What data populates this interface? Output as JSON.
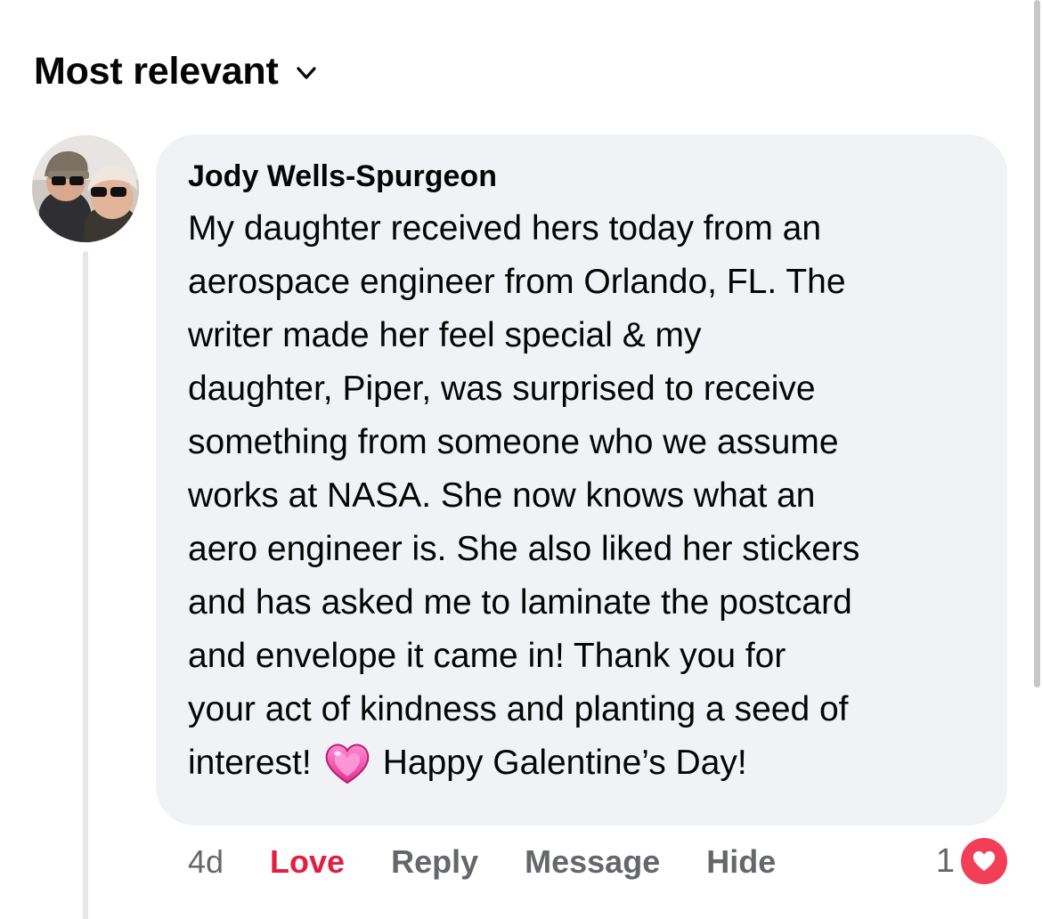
{
  "sort": {
    "label": "Most relevant",
    "chevron_icon": "chevron-down-icon"
  },
  "comment": {
    "author": "Jody Wells-Spurgeon",
    "text_main": "My daughter received hers today from an\naerospace engineer from Orlando, FL. The\nwriter made her feel special & my\ndaughter, Piper, was surprised to receive\nsomething from someone who we assume\nworks at NASA. She now knows what an\naero engineer is. She also liked her stickers\nand has asked me to laminate the postcard\nand envelope it came in! Thank you for\nyour act of kindness and planting a seed of",
    "text_before_emoji": "interest!",
    "emoji": "sparkling-heart-emoji",
    "text_after_emoji": "Happy Galentine’s Day!"
  },
  "actions": {
    "time": "4d",
    "love_label": "Love",
    "reply_label": "Reply",
    "message_label": "Message",
    "hide_label": "Hide"
  },
  "reactions": {
    "count": "1",
    "icon": "love-reaction-icon",
    "color": "#f33e58"
  },
  "colors": {
    "bubble_bg": "#f0f2f5",
    "love_active": "#e41e3f",
    "secondary_text": "#65676b"
  }
}
